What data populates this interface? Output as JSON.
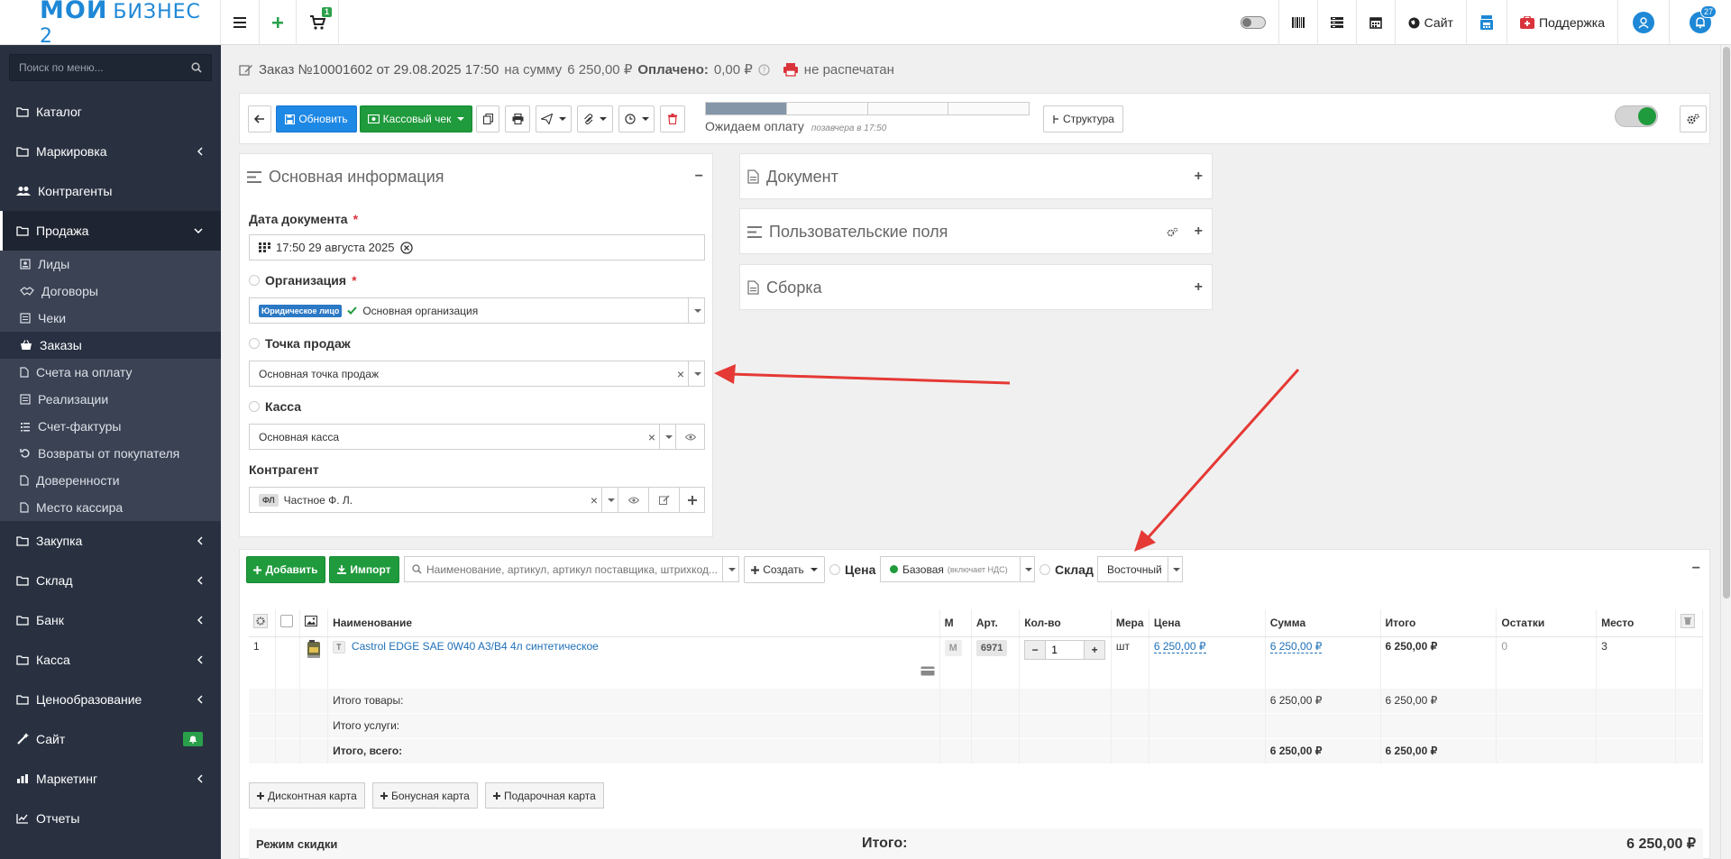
{
  "app": {
    "logo_line1": "МОЙ",
    "logo_line2": "БИЗНЕС 2"
  },
  "topbar": {
    "cart_count": "1",
    "site_label": "Сайт",
    "support_label": "Поддержка",
    "notifications_count": "27"
  },
  "sidebar": {
    "search_placeholder": "Поиск по меню...",
    "items": [
      {
        "label": "Каталог"
      },
      {
        "label": "Маркировка"
      },
      {
        "label": "Контрагенты"
      },
      {
        "label": "Продажа"
      },
      {
        "label": "Закупка"
      },
      {
        "label": "Склад"
      },
      {
        "label": "Банк"
      },
      {
        "label": "Касса"
      },
      {
        "label": "Ценообразование"
      },
      {
        "label": "Сайт"
      },
      {
        "label": "Маркетинг"
      },
      {
        "label": "Отчеты"
      }
    ],
    "sub_items": [
      {
        "label": "Лиды"
      },
      {
        "label": "Договоры"
      },
      {
        "label": "Чеки"
      },
      {
        "label": "Заказы"
      },
      {
        "label": "Счета на оплату"
      },
      {
        "label": "Реализации"
      },
      {
        "label": "Счет-фактуры"
      },
      {
        "label": "Возвраты от покупателя"
      },
      {
        "label": "Доверенности"
      },
      {
        "label": "Место кассира"
      }
    ]
  },
  "order": {
    "title": "Заказ №10001602 от 29.08.2025 17:50",
    "sum_prefix": "на сумму",
    "sum": "6 250,00 ₽",
    "paid_label": "Оплачено:",
    "paid_value": "0,00 ₽",
    "print_status": "не распечатан"
  },
  "toolbar": {
    "refresh_label": "Обновить",
    "receipt_label": "Кассовый чек",
    "status_label": "Ожидаем оплату",
    "status_time": "позавчера в 17:50",
    "structure_label": "Структура",
    "progress": 0.25
  },
  "main_info": {
    "title": "Основная информация",
    "date_label": "Дата документа",
    "date_value": "17:50 29 августа 2025",
    "org_label": "Организация",
    "org_tag": "Юридическое лицо",
    "org_value": "Основная организация",
    "pos_label": "Точка продаж",
    "pos_value": "Основная точка продаж",
    "cash_label": "Касса",
    "cash_value": "Основная касса",
    "contractor_label": "Контрагент",
    "contractor_tag": "ФЛ",
    "contractor_value": "Частное Ф. Л."
  },
  "side_panels": {
    "document": "Документ",
    "custom_fields": "Пользовательские поля",
    "assembly": "Сборка"
  },
  "goods": {
    "add_label": "Добавить",
    "import_label": "Импорт",
    "search_placeholder": "Наименование, артикул, артикул поставщика, штрихкод...",
    "create_label": "Создать",
    "price_label": "Цена",
    "price_value": "Базовая",
    "price_note": "(включает НДС)",
    "warehouse_label": "Склад",
    "warehouse_value": "Восточный",
    "columns": [
      "Наименование",
      "М",
      "Арт.",
      "Кол-во",
      "Мера",
      "Цена",
      "Сумма",
      "Итого",
      "Остатки",
      "Место"
    ],
    "rows": [
      {
        "n": "1",
        "type_tag": "Т",
        "name": "Castrol EDGE SAE 0W40 A3/B4 4л синтетическое",
        "m": "М",
        "art": "6971",
        "qty": "1",
        "unit": "шт",
        "price": "6 250,00 ₽",
        "sum": "6 250,00 ₽",
        "total": "6 250,00 ₽",
        "stock": "0",
        "place": "3"
      }
    ],
    "sum_goods_label": "Итого товары:",
    "sum_goods_sum": "6 250,00 ₽",
    "sum_goods_total": "6 250,00 ₽",
    "sum_services_label": "Итого услуги:",
    "sum_all_label": "Итого, всего:",
    "sum_all_sum": "6 250,00 ₽",
    "sum_all_total": "6 250,00 ₽",
    "discount_card": "Дисконтная карта",
    "bonus_card": "Бонусная карта",
    "gift_card": "Подарочная карта",
    "discount_mode_label": "Режим скидки",
    "grand_total_label": "Итого:",
    "grand_total_value": "6 250,00 ₽"
  },
  "colors": {
    "accent_blue": "#1e88e5",
    "accent_green": "#1f9a3c",
    "sidebar_bg": "#293141",
    "arrow_red": "#e53935"
  }
}
